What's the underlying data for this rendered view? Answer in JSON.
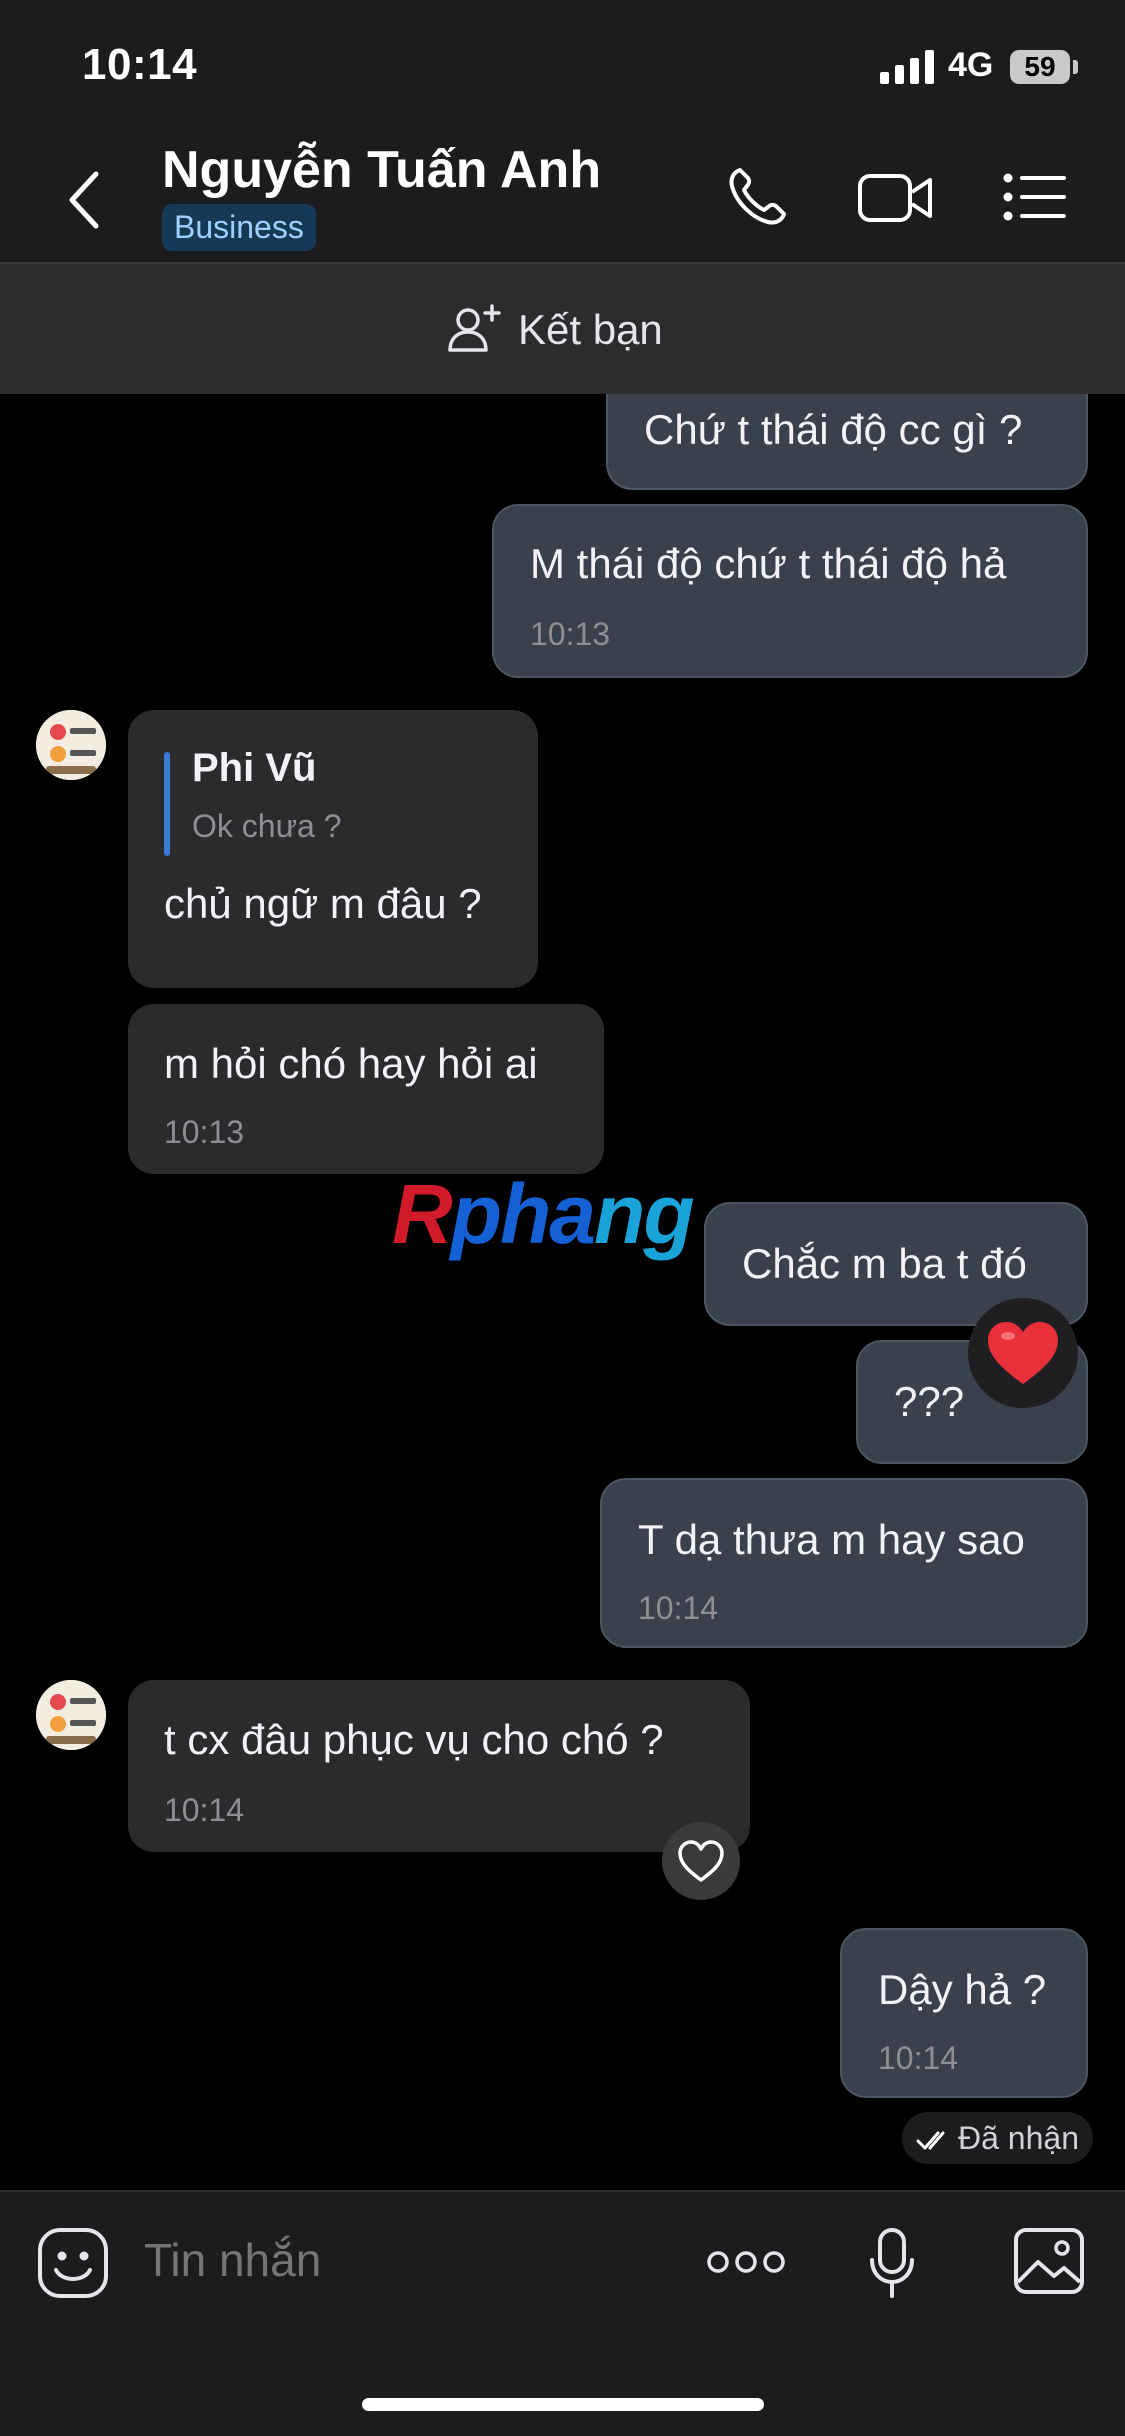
{
  "status_bar": {
    "time": "10:14",
    "network": "4G",
    "battery": "59"
  },
  "header": {
    "contact_name": "Nguyễn Tuấn Anh",
    "badge": "Business",
    "icons": [
      "back-chevron-icon",
      "phone-icon",
      "video-call-icon",
      "list-menu-icon"
    ]
  },
  "friend_bar": {
    "label": "Kết bạn",
    "icon": "add-friend-icon"
  },
  "messages": [
    {
      "dir": "out",
      "text": "Chứ t thái độ cc gì ?"
    },
    {
      "dir": "out",
      "text": "M thái độ chứ t thái độ hả",
      "time": "10:13"
    },
    {
      "dir": "in",
      "reply_name": "Phi Vũ",
      "reply_text": "Ok chưa ?",
      "text": "chủ ngữ m đâu ?"
    },
    {
      "dir": "in",
      "text": "m hỏi chó hay hỏi ai",
      "time": "10:13"
    },
    {
      "dir": "out",
      "text": "Chắc m ba t đó"
    },
    {
      "dir": "out",
      "text": "???",
      "reaction": "heart"
    },
    {
      "dir": "out",
      "text": "T dạ thưa m hay sao",
      "time": "10:14"
    },
    {
      "dir": "in",
      "text": "t cx đâu phục vụ cho chó ?",
      "time": "10:14",
      "reaction": "heart-outline"
    },
    {
      "dir": "out",
      "text": "Dậy hả ?",
      "time": "10:14"
    }
  ],
  "delivery_status": "Đã nhận",
  "watermark": "Rphang",
  "composer": {
    "placeholder": "Tin nhắn",
    "icons": [
      "sticker-icon",
      "more-icon",
      "microphone-icon",
      "image-icon"
    ]
  },
  "colors": {
    "outgoing_bubble": "#3a414c",
    "incoming_bubble": "#2b2b2d",
    "accent": "#3a7bd5",
    "reaction_heart": "#e8303a"
  }
}
